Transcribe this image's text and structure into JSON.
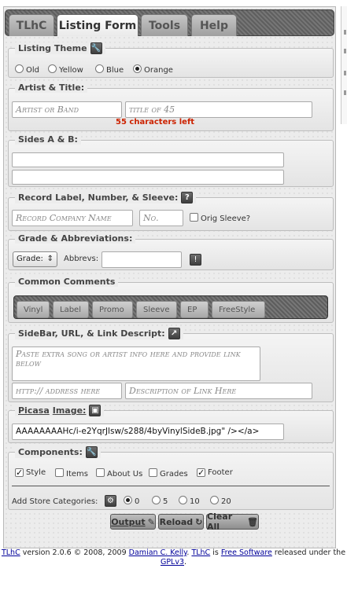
{
  "tabs": [
    {
      "label": "TLhC"
    },
    {
      "label": "Listing Form"
    },
    {
      "label": "Tools"
    },
    {
      "label": "Help"
    }
  ],
  "listing_theme": {
    "legend": "Listing Theme",
    "options": [
      "Old",
      "Yellow",
      "Blue",
      "Orange"
    ],
    "selected": "Orange"
  },
  "artist_title": {
    "legend": "Artist & Title:",
    "artist_placeholder": "Artist or Band",
    "title_placeholder": "title of 45",
    "chars_left": "55 characters left"
  },
  "sides": {
    "legend": "Sides A & B:",
    "side_a": "",
    "side_b": ""
  },
  "record_label": {
    "legend": "Record Label, Number, & Sleeve:",
    "help_icon": "?",
    "company_placeholder": "Record Company Name",
    "number_placeholder": "No.",
    "orig_sleeve_label": "Orig Sleeve?"
  },
  "grade": {
    "legend": "Grade & Abbreviations:",
    "grade_select": "Grade:",
    "abbrevs_label": "Abbrevs:",
    "abbrevs_value": "",
    "bang_icon": "!"
  },
  "common_comments": {
    "legend": "Common Comments",
    "chips": [
      "Vinyl",
      "Label",
      "Promo",
      "Sleeve",
      "EP",
      "FreeStyle"
    ]
  },
  "sidebar": {
    "legend": "SideBar, URL, & Link Descript:",
    "extra_placeholder": "Paste extra song or artist info here and provide link below",
    "url_placeholder": "http:// address here",
    "desc_placeholder": "Description of Link Here"
  },
  "picasa": {
    "legend_a": "Picasa",
    "legend_b": "Image:",
    "value": "AAAAAAAAHc/i-e2YqrJlsw/s288/4byVinylSideB.jpg\" /></a>"
  },
  "components": {
    "legend": "Components:",
    "items": [
      {
        "label": "Style",
        "checked": true
      },
      {
        "label": "Items",
        "checked": false
      },
      {
        "label": "About Us",
        "checked": false
      },
      {
        "label": "Grades",
        "checked": false
      },
      {
        "label": "Footer",
        "checked": true
      }
    ],
    "store_label": "Add Store Categories:",
    "store_options": [
      "0",
      "5",
      "10",
      "20"
    ],
    "store_selected": "0"
  },
  "buttons": {
    "output": "Output",
    "reload": "Reload",
    "clear_all": "Clear All"
  },
  "footer": {
    "app": "TLhC",
    "version_text": " version 2.0.6 © 2008, 2009 ",
    "author": "Damian C. Kelly",
    "dot": ". ",
    "app2": "TLhC",
    "is": " is ",
    "free": "Free Software",
    "released": " released under the ",
    "license": "GPLv3",
    "end": "."
  }
}
